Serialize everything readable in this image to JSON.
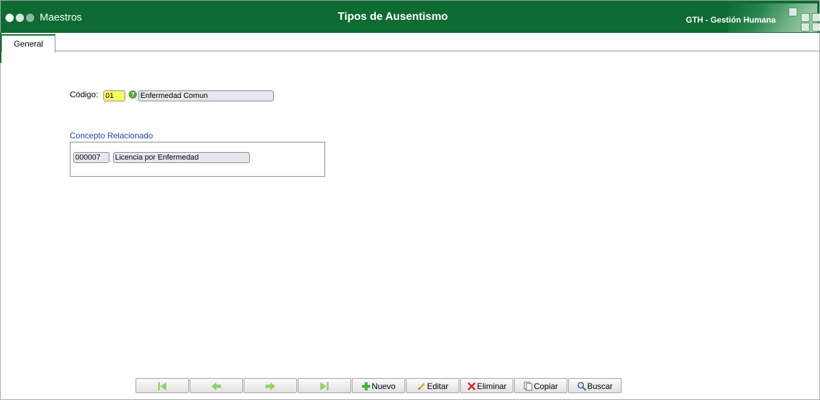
{
  "header": {
    "module": "Maestros",
    "title": "Tipos de Ausentismo",
    "app_name": "GTH - Gestión Humana",
    "color": "#0e6b33"
  },
  "tabs": [
    {
      "label": "General",
      "active": true
    }
  ],
  "form": {
    "codigo_label": "Código:",
    "codigo_value": "01",
    "descripcion_value": "Enfermedad Comun",
    "help_icon": "help-circle-icon"
  },
  "concepto": {
    "title": "Concepto Relacionado",
    "code_value": "000007",
    "desc_value": "Licencia por Enfermedad"
  },
  "toolbar": {
    "first_icon": "first-record-icon",
    "prev_icon": "prev-record-icon",
    "next_icon": "next-record-icon",
    "last_icon": "last-record-icon",
    "nuevo": "Nuevo",
    "editar": "Editar",
    "eliminar": "Eliminar",
    "copiar": "Copiar",
    "buscar": "Buscar"
  }
}
